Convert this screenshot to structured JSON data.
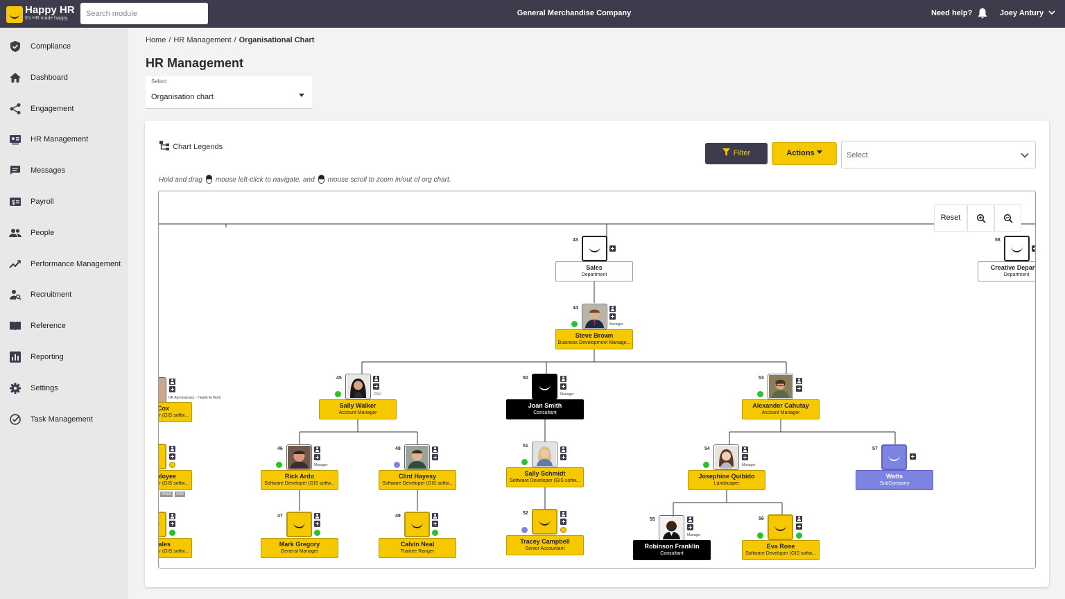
{
  "topbar": {
    "logo_name": "Happy HR",
    "logo_tagline": "It's HR made happy.",
    "search_placeholder": "Search module",
    "company": "General Merchandise Company",
    "help": "Need help?",
    "user": "Joey Antury"
  },
  "sidebar": {
    "items": [
      {
        "label": "Compliance",
        "icon": "shield-check-icon"
      },
      {
        "label": "Dashboard",
        "icon": "home-icon"
      },
      {
        "label": "Engagement",
        "icon": "share-icon"
      },
      {
        "label": "HR Management",
        "icon": "id-card-icon"
      },
      {
        "label": "Messages",
        "icon": "chat-icon"
      },
      {
        "label": "Payroll",
        "icon": "dollar-icon"
      },
      {
        "label": "People",
        "icon": "people-icon"
      },
      {
        "label": "Performance Management",
        "icon": "trend-icon"
      },
      {
        "label": "Recruitment",
        "icon": "person-search-icon"
      },
      {
        "label": "Reference",
        "icon": "book-icon"
      },
      {
        "label": "Reporting",
        "icon": "bar-chart-icon"
      },
      {
        "label": "Settings",
        "icon": "gear-icon"
      },
      {
        "label": "Task Management",
        "icon": "check-circle-icon"
      }
    ]
  },
  "breadcrumb": {
    "home": "Home",
    "section": "HR Management",
    "current": "Organisational Chart"
  },
  "page": {
    "title": "HR Management",
    "select_label": "Select",
    "select_value": "Organisation chart"
  },
  "toolbar": {
    "legend": "Chart Legends",
    "filter": "Filter",
    "actions": "Actions",
    "select_placeholder": "Select",
    "hint_a": "Hold and drag",
    "hint_b": "mouse left-click to navigate, and",
    "hint_c": "mouse scroll to zoom in/out of org chart."
  },
  "controls": {
    "reset": "Reset"
  },
  "org": {
    "n43": {
      "id": "43",
      "name": "Sales",
      "role": "Department"
    },
    "n58": {
      "id": "58",
      "name": "Creative Departm",
      "role": "Department"
    },
    "n44": {
      "id": "44",
      "name": "Steve Brown",
      "role": "Business Development Manage...",
      "tag": "Manager"
    },
    "n45": {
      "id": "45",
      "name": "Sally Walker",
      "role": "Account Manager",
      "tag": "CSV"
    },
    "n50": {
      "id": "50",
      "name": "Joan Smith",
      "role": "Consultant",
      "tag": "Manager"
    },
    "n53": {
      "id": "53",
      "name": "Alexander Cahutay",
      "role": "Account Manager"
    },
    "n46": {
      "id": "46",
      "name": "Rick Ardo",
      "role": "Software Developer (GIS softw...",
      "tag": "Manager"
    },
    "n48": {
      "id": "48",
      "name": "Clint Hayesy",
      "role": "Software Developer (GIS softw..."
    },
    "n51": {
      "id": "51",
      "name": "Sally Schmidt",
      "role": "Software Developer (GIS softw..."
    },
    "n54": {
      "id": "54",
      "name": "Josephine Quibido",
      "role": "Landscaper",
      "tag": "Manager"
    },
    "n57": {
      "id": "57",
      "name": "Watts",
      "role": "SubCompany"
    },
    "n47": {
      "id": "47",
      "name": "Mark Gregory",
      "role": "General Manager"
    },
    "n49": {
      "id": "49",
      "name": "Calvin Neal",
      "role": "Trainee Ranger"
    },
    "n52": {
      "id": "52",
      "name": "Tracey Campbell",
      "role": "Senior Accountant"
    },
    "n55": {
      "id": "55",
      "name": "Robinson Franklin",
      "role": "Consultant",
      "tag": "Manager"
    },
    "n56": {
      "id": "56",
      "name": "Eva Rose",
      "role": "Software Developer (GIS softw..."
    },
    "left1": {
      "name": "Cox",
      "role": "r (GIS softw...",
      "tag": "HR Administrator - Health At Work"
    },
    "left2": {
      "name": "ployee",
      "role": "r (GIS softw...",
      "tags": [
        "OH&S",
        "SHO"
      ]
    },
    "left3": {
      "name": "ales",
      "role": "r (GIS softw..."
    }
  },
  "colors": {
    "accent": "#f5c800",
    "dark": "#3c3c4c",
    "subcompany": "#7d83e0"
  }
}
